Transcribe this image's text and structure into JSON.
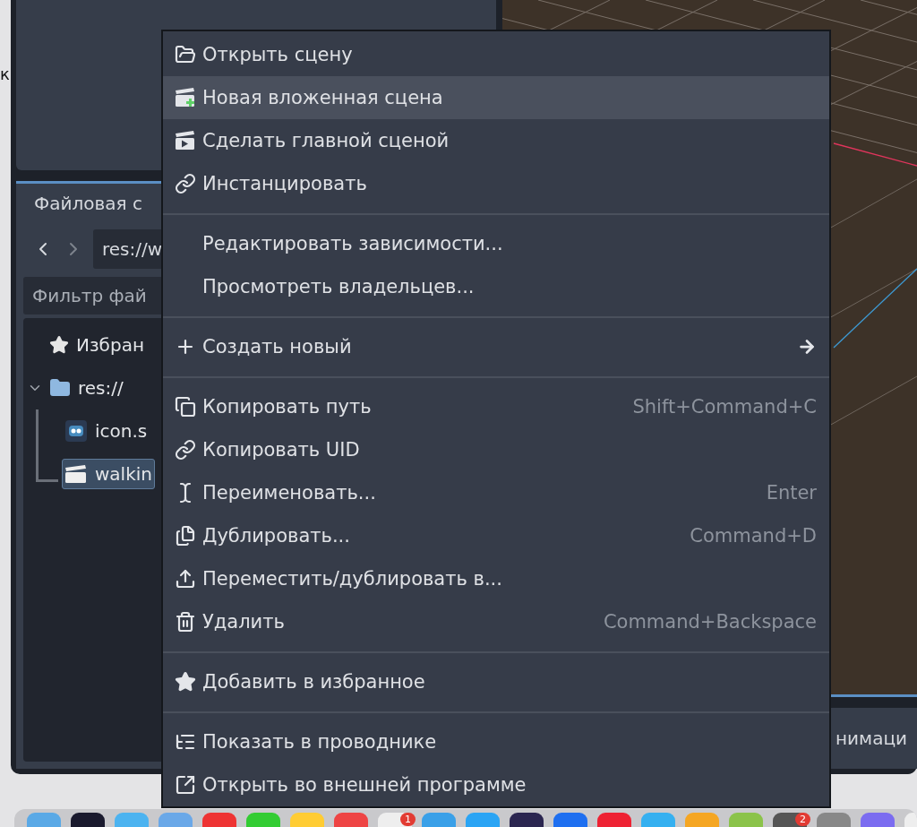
{
  "edge_text": "к",
  "filesystem": {
    "tab": "Файловая с",
    "path": "res://w",
    "filter_placeholder": "Фильтр фай",
    "tree": [
      {
        "label": "Избран",
        "kind": "favorites",
        "selected": false
      },
      {
        "label": "res://",
        "kind": "folder",
        "selected": false,
        "expanded": true,
        "children": [
          {
            "label": "icon.s",
            "kind": "image",
            "selected": false
          },
          {
            "label": "walkin",
            "kind": "scene",
            "selected": true
          }
        ]
      }
    ]
  },
  "bottom_panel": {
    "tab": "нимаци"
  },
  "context_menu": {
    "items": [
      {
        "kind": "item",
        "label": "Открыть сцену",
        "highlighted": false
      },
      {
        "kind": "item",
        "label": "Новая вложенная сцена",
        "highlighted": true
      },
      {
        "kind": "item",
        "label": "Сделать главной сценой",
        "highlighted": false
      },
      {
        "kind": "item",
        "label": "Инстанцировать",
        "highlighted": false
      },
      {
        "kind": "separator"
      },
      {
        "kind": "item",
        "label": "Редактировать зависимости...",
        "highlighted": false
      },
      {
        "kind": "item",
        "label": "Просмотреть владельцев...",
        "highlighted": false
      },
      {
        "kind": "separator"
      },
      {
        "kind": "item",
        "label": "Создать новый",
        "highlighted": false,
        "submenu": true
      },
      {
        "kind": "separator"
      },
      {
        "kind": "item",
        "label": "Копировать путь",
        "highlighted": false,
        "shortcut": "Shift+Command+C"
      },
      {
        "kind": "item",
        "label": "Копировать UID",
        "highlighted": false
      },
      {
        "kind": "item",
        "label": "Переименовать...",
        "highlighted": false,
        "shortcut": "Enter"
      },
      {
        "kind": "item",
        "label": "Дублировать...",
        "highlighted": false,
        "shortcut": "Command+D"
      },
      {
        "kind": "item",
        "label": "Переместить/дублировать в...",
        "highlighted": false
      },
      {
        "kind": "item",
        "label": "Удалить",
        "highlighted": false,
        "shortcut": "Command+Backspace"
      },
      {
        "kind": "separator"
      },
      {
        "kind": "item",
        "label": "Добавить в избранное",
        "highlighted": false
      },
      {
        "kind": "separator"
      },
      {
        "kind": "item",
        "label": "Показать в проводнике",
        "highlighted": false
      },
      {
        "kind": "item",
        "label": "Открыть во внешней программе",
        "highlighted": false
      }
    ]
  },
  "dock_badges": [
    {
      "text": "1"
    },
    {
      "text": "2"
    }
  ]
}
